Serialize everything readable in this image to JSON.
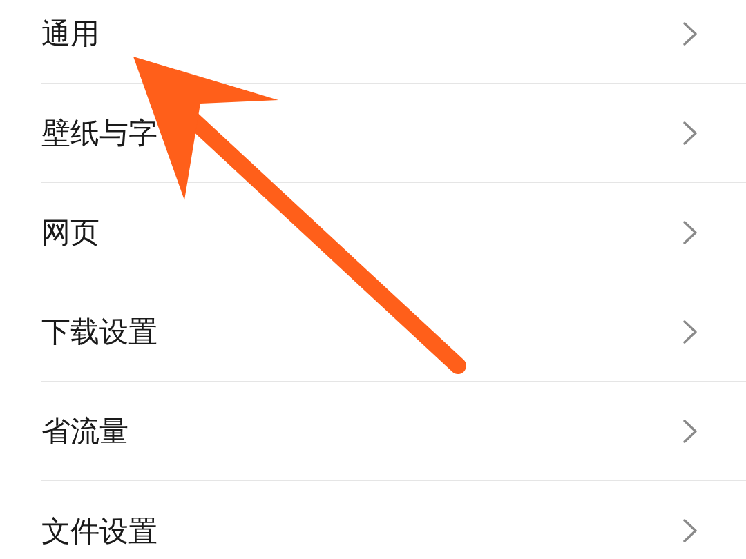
{
  "settings_list": {
    "items": [
      {
        "label": "通用"
      },
      {
        "label": "壁纸与字"
      },
      {
        "label": "网页"
      },
      {
        "label": "下载设置"
      },
      {
        "label": "省流量"
      },
      {
        "label": "文件设置"
      }
    ]
  }
}
